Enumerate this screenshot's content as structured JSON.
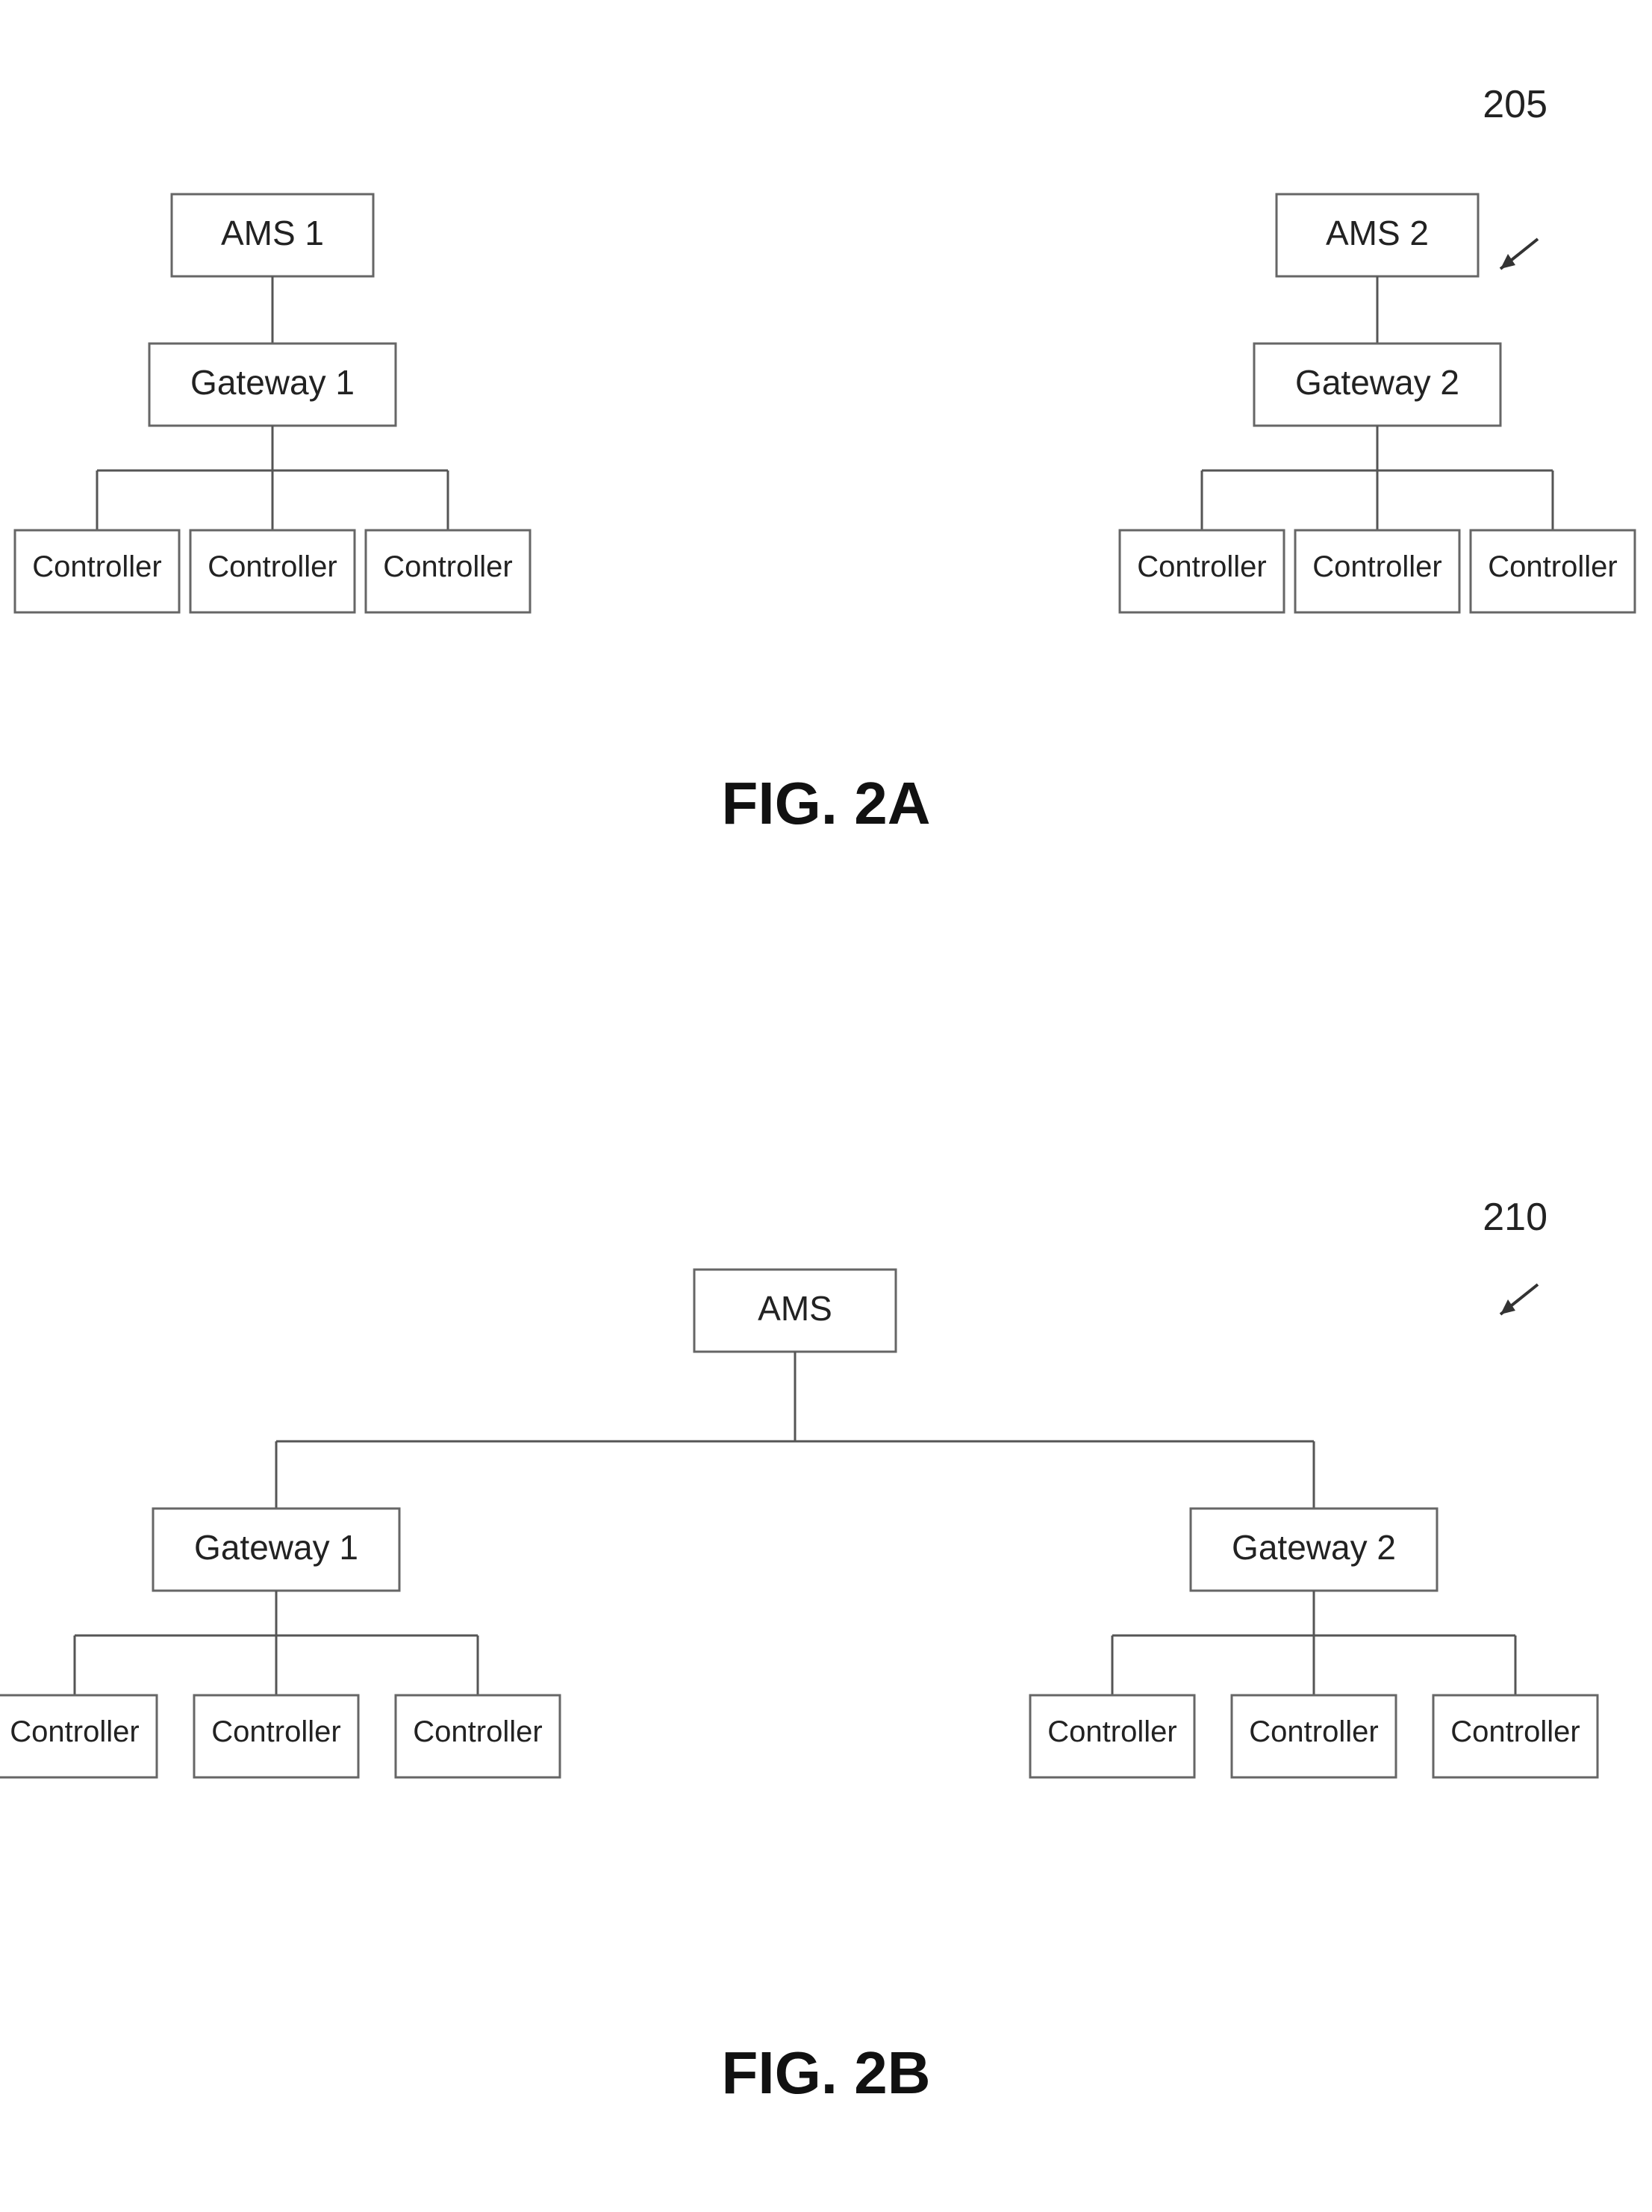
{
  "fig2a": {
    "ref": "205",
    "label": "FIG. 2A",
    "top_left": {
      "ams": "AMS 1",
      "gateway": "Gateway 1",
      "controllers": [
        "Controller",
        "Controller",
        "Controller"
      ]
    },
    "top_right": {
      "ams": "AMS 2",
      "gateway": "Gateway 2",
      "controllers": [
        "Controller",
        "Controller",
        "Controller"
      ]
    }
  },
  "fig2b": {
    "ref": "210",
    "label": "FIG. 2B",
    "ams": "AMS",
    "left_gateway": "Gateway 1",
    "right_gateway": "Gateway 2",
    "left_controllers": [
      "Controller",
      "Controller",
      "Controller"
    ],
    "right_controllers": [
      "Controller",
      "Controller",
      "Controller"
    ]
  }
}
